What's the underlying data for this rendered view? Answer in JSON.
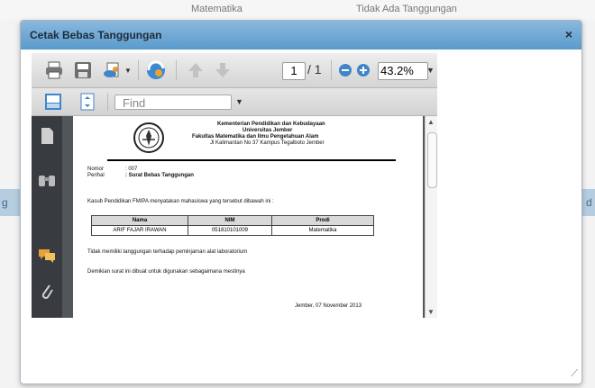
{
  "background": {
    "top_col1": "Matematika",
    "top_col2": "Tidak Ada Tanggungan",
    "band_left": "g",
    "band_right": "d"
  },
  "dialog": {
    "title": "Cetak Bebas Tanggungan",
    "close_icon": "×"
  },
  "pdf_toolbar": {
    "page_current": "1",
    "page_total": "/ 1",
    "zoom": "43.2%",
    "find_placeholder": "Find",
    "icons": [
      "print-icon",
      "save-icon",
      "share-icon",
      "collaborate-icon",
      "previous-page-icon",
      "next-page-icon",
      "zoom-out-icon",
      "zoom-in-icon",
      "fit-width-icon",
      "fit-page-icon"
    ]
  },
  "sidebar": {
    "icons": [
      "pages-icon",
      "bookmarks-icon",
      "comments-icon",
      "attachments-icon"
    ]
  },
  "document": {
    "header_line1": "Kementerian Pendidikan dan Kebudayaan",
    "header_line2": "Universitas Jember",
    "header_line3": "Fakultas Matematika dan Ilmu Pengetahuan Alam",
    "header_line4": "Jl Kalimantan No 37 Kampus Tegalboto Jember",
    "nomor_label": "Nomor",
    "nomor_value": ": 007",
    "perihal_label": "Perihal",
    "perihal_value": ": Surat Bebas Tanggungan",
    "intro": "Kasub Pendidikan FMIPA menyatakan mahasiswa yang tersebut dibawah ini :",
    "table_headers": [
      "Nama",
      "NIM",
      "Prodi"
    ],
    "table_row": [
      "ARIF FAJAR IRAWAN",
      "051810101009",
      "Matematika"
    ],
    "statement": "Tidak memiliki tanggungan terhadap peminjaman alat laboratorium",
    "closing": "Demikian surat ini dibuat untuk digunakan sebagaimana mestinya",
    "date_line": "Jember, 07 November 2013"
  }
}
